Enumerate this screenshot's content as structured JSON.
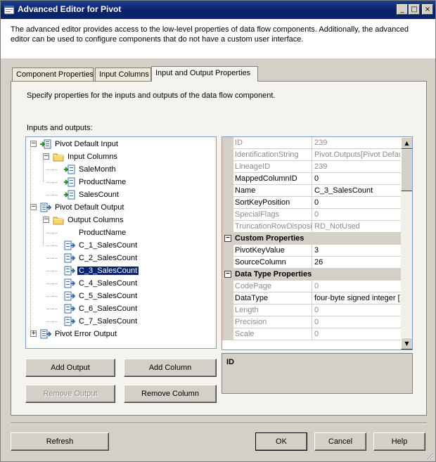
{
  "window": {
    "title": "Advanced Editor for Pivot",
    "minimize_glyph": "_",
    "maximize_glyph": "□",
    "close_glyph": "×"
  },
  "description": "The advanced editor provides access to the low-level properties of data flow components. Additionally, the advanced editor can be used to configure components that do not have a custom user interface.",
  "tabs": [
    {
      "label": "Component Properties"
    },
    {
      "label": "Input Columns"
    },
    {
      "label": "Input and Output Properties"
    }
  ],
  "panel": {
    "description": "Specify properties for the inputs and outputs of the data flow component.",
    "io_label": "Inputs and outputs:"
  },
  "tree": [
    {
      "label": "Pivot Default Input",
      "icon": "input-icon",
      "level": 0,
      "expander": "−"
    },
    {
      "label": "Input Columns",
      "icon": "folder-icon",
      "level": 1,
      "expander": "−"
    },
    {
      "label": "SaleMonth",
      "icon": "input-column-icon",
      "level": 2
    },
    {
      "label": "ProductName",
      "icon": "input-column-icon",
      "level": 2
    },
    {
      "label": "SalesCount",
      "icon": "input-column-icon",
      "level": 2
    },
    {
      "label": "Pivot Default Output",
      "icon": "output-icon",
      "level": 0,
      "expander": "−"
    },
    {
      "label": "Output Columns",
      "icon": "folder-icon",
      "level": 1,
      "expander": "−"
    },
    {
      "label": "ProductName",
      "icon": "none",
      "level": 2
    },
    {
      "label": "C_1_SalesCount",
      "icon": "output-column-icon",
      "level": 2
    },
    {
      "label": "C_2_SalesCount",
      "icon": "output-column-icon",
      "level": 2
    },
    {
      "label": "C_3_SalesCount",
      "icon": "output-column-icon",
      "level": 2,
      "selected": true
    },
    {
      "label": "C_4_SalesCount",
      "icon": "output-column-icon",
      "level": 2
    },
    {
      "label": "C_5_SalesCount",
      "icon": "output-column-icon",
      "level": 2
    },
    {
      "label": "C_6_SalesCount",
      "icon": "output-column-icon",
      "level": 2
    },
    {
      "label": "C_7_SalesCount",
      "icon": "output-column-icon",
      "level": 2
    },
    {
      "label": "Pivot Error Output",
      "icon": "output-icon",
      "level": 0,
      "expander": "+"
    }
  ],
  "properties": [
    {
      "name": "ID",
      "value": "239",
      "readonly": true
    },
    {
      "name": "IdentificationString",
      "value": "Pivot.Outputs[Pivot Defau",
      "readonly": true
    },
    {
      "name": "LineageID",
      "value": "239",
      "readonly": true
    },
    {
      "name": "MappedColumnID",
      "value": "0"
    },
    {
      "name": "Name",
      "value": "C_3_SalesCount"
    },
    {
      "name": "SortKeyPosition",
      "value": "0"
    },
    {
      "name": "SpecialFlags",
      "value": "0",
      "readonly": true
    },
    {
      "name": "TruncationRowDisposition",
      "value": "RD_NotUsed",
      "readonly": true
    },
    {
      "category": "Custom Properties",
      "toggle": "−"
    },
    {
      "name": "PivotKeyValue",
      "value": "3"
    },
    {
      "name": "SourceColumn",
      "value": "26"
    },
    {
      "category": "Data Type Properties",
      "toggle": "−"
    },
    {
      "name": "CodePage",
      "value": "0",
      "readonly": true
    },
    {
      "name": "DataType",
      "value": "four-byte signed integer ["
    },
    {
      "name": "Length",
      "value": "0",
      "readonly": true
    },
    {
      "name": "Precision",
      "value": "0",
      "readonly": true
    },
    {
      "name": "Scale",
      "value": "0",
      "readonly": true
    }
  ],
  "help": {
    "title": "ID"
  },
  "buttons": {
    "add_output": "Add Output",
    "add_column": "Add Column",
    "remove_output": "Remove Output",
    "remove_column": "Remove Column",
    "refresh": "Refresh",
    "ok": "OK",
    "cancel": "Cancel",
    "help": "Help"
  },
  "scrollbar": {
    "up_glyph": "▲",
    "down_glyph": "▼"
  },
  "colors": {
    "selection": "#0a246a",
    "title_bar": "#0a246a",
    "dialog_bg": "#d4d0c8"
  }
}
